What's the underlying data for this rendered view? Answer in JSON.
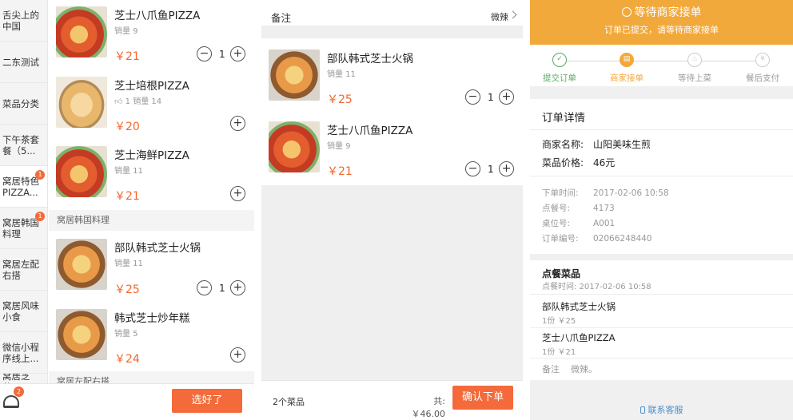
{
  "menu": {
    "categories": [
      {
        "label": "舌尖上的中国",
        "badge": ""
      },
      {
        "label": "二东测试",
        "badge": ""
      },
      {
        "label": "菜品分类",
        "badge": ""
      },
      {
        "label": "下午茶套餐（5...",
        "badge": ""
      },
      {
        "label": "窝居特色PIZZA...",
        "badge": "1"
      },
      {
        "label": "窝居韩国料理",
        "badge": "1"
      },
      {
        "label": "窝居左配右搭",
        "badge": ""
      },
      {
        "label": "窝居风味小食",
        "badge": ""
      },
      {
        "label": "微信小程序线上...",
        "badge": ""
      },
      {
        "label": "窝居芝芝...",
        "badge": ""
      }
    ],
    "items": [
      {
        "name": "芝士八爪鱼PIZZA",
        "sales": "销量 9",
        "price": "￥21",
        "qty": "1"
      },
      {
        "name": "芝士培根PIZZA",
        "likes": "1",
        "sales": "销量 14",
        "price": "￥20"
      },
      {
        "name": "芝士海鲜PIZZA",
        "sales": "销量 11",
        "price": "￥21"
      }
    ],
    "section_korean": "窝居韩国料理",
    "korean_items": [
      {
        "name": "部队韩式芝士火锅",
        "sales": "销量 11",
        "price": "￥25",
        "qty": "1"
      },
      {
        "name": "韩式芝士炒年糕",
        "sales": "销量 5",
        "price": "￥24"
      }
    ],
    "next_section": "窝居左配右搭",
    "cart_badge": "2",
    "choose_label": "选好了"
  },
  "confirm": {
    "remark_label": "备注",
    "remark_value": "微辣",
    "items": [
      {
        "name": "部队韩式芝士火锅",
        "sales": "销量 11",
        "price": "￥25",
        "qty": "1"
      },
      {
        "name": "芝士八爪鱼PIZZA",
        "sales": "销量 9",
        "price": "￥21",
        "qty": "1"
      }
    ],
    "count": "2个菜品",
    "total": "共:￥46.00",
    "confirm_label": "确认下单"
  },
  "status": {
    "title": "等待商家接单",
    "subtitle": "订单已提交，请等待商家接单",
    "steps": [
      {
        "label": "提交订单",
        "glyph": "✓"
      },
      {
        "label": "商家接单",
        "glyph": "▤"
      },
      {
        "label": "等待上菜",
        "glyph": "♨"
      },
      {
        "label": "餐后支付",
        "glyph": "¥"
      }
    ],
    "detail_title": "订单详情",
    "merchant_key": "商家名称:",
    "merchant_val": "山阳美味生煎",
    "price_key": "菜品价格:",
    "price_val": "46元",
    "order_time_key": "下单时间:",
    "order_time_val": "2017-02-06 10:58",
    "order_no_key": "点餐号:",
    "order_no_val": "4173",
    "table_key": "桌位号:",
    "table_val": "A001",
    "serial_key": "订单编号:",
    "serial_val": "02066248440",
    "dishes_title": "点餐菜品",
    "dishes_time": "点餐时间: 2017-02-06 10:58",
    "dishes": [
      {
        "name": "部队韩式芝士火锅",
        "sub": "1份  ￥25"
      },
      {
        "name": "芝士八爪鱼PIZZA",
        "sub": "1份  ￥21"
      }
    ],
    "remark_key": "备注",
    "remark_val": "微辣。",
    "service_label": "联系客服"
  }
}
